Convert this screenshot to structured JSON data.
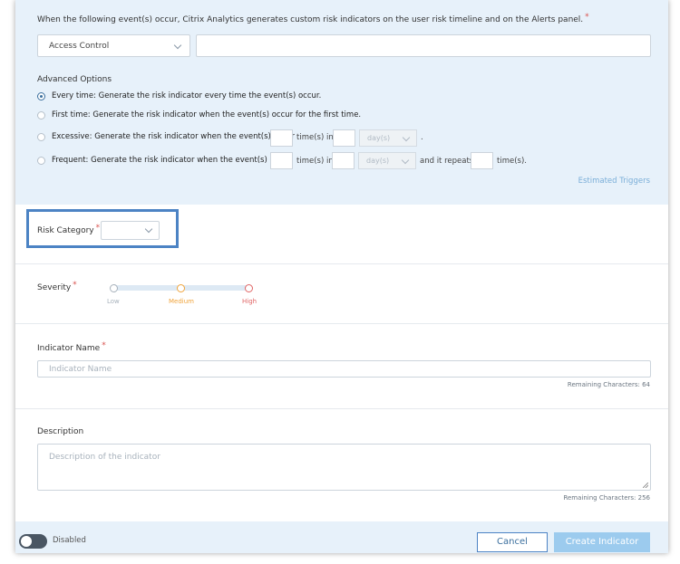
{
  "event_section": {
    "intro": "When the following event(s) occur, Citrix Analytics generates custom risk indicators on the user risk timeline and on the Alerts panel.",
    "required_mark": "*",
    "event_select_value": "Access Control",
    "event_condition_value": ""
  },
  "advanced_options": {
    "title": "Advanced Options",
    "options": [
      {
        "label": "Every time:",
        "desc": "Generate the risk indicator every time the event(s) occur.",
        "checked": true
      },
      {
        "label": "First time:",
        "desc": "Generate the risk indicator when the event(s) occur for the first time.",
        "checked": false
      },
      {
        "label": "Excessive:",
        "desc": "Generate the risk indicator when the event(s) occur",
        "checked": false,
        "times_in": "time(s) in",
        "unit_select": "day(s)",
        "period_end": "."
      },
      {
        "label": "Frequent:",
        "desc": "Generate the risk indicator when the event(s) occur",
        "checked": false,
        "times_in": "time(s) in",
        "unit_select": "day(s)",
        "repeats": "and it repeats",
        "times_end": "time(s)."
      }
    ],
    "estimated_triggers": "Estimated Triggers"
  },
  "risk_category": {
    "label": "Risk Category",
    "required_mark": "*",
    "value": ""
  },
  "severity": {
    "label": "Severity",
    "required_mark": "*",
    "levels": [
      {
        "name": "Low",
        "color": "#a8b2bc"
      },
      {
        "name": "Medium",
        "color": "#f0a43c"
      },
      {
        "name": "High",
        "color": "#e06565"
      }
    ]
  },
  "indicator_name": {
    "label": "Indicator Name",
    "required_mark": "*",
    "placeholder": "Indicator Name",
    "remaining": "Remaining Characters: 64"
  },
  "description": {
    "label": "Description",
    "placeholder": "Description of the indicator",
    "remaining": "Remaining Characters: 256"
  },
  "footer": {
    "toggle_label": "Disabled",
    "cancel_label": "Cancel",
    "create_label": "Create Indicator"
  },
  "colors": {
    "panel_bg": "#e7f1fa",
    "accent": "#4c83c4",
    "required": "#d9534f",
    "primary_button_disabled": "#9ccbee"
  }
}
